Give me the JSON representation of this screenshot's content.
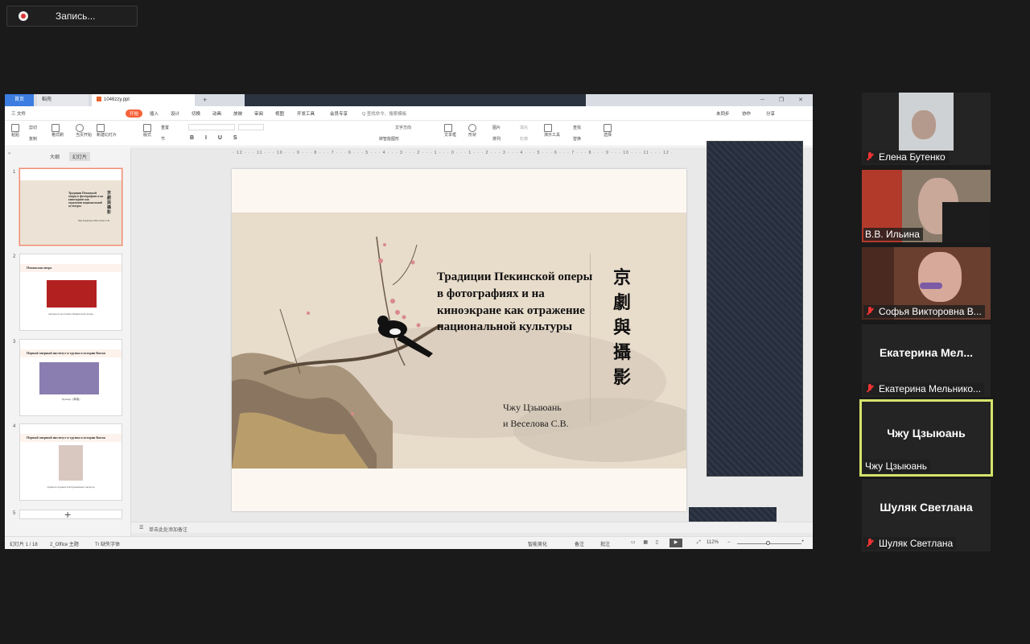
{
  "recording": {
    "label": "Запись..."
  },
  "window": {
    "tabs": {
      "home": "首页",
      "wps": "稻壳",
      "doc": "1046zzy.ppt",
      "plus": "+"
    },
    "menu": [
      "三 文件",
      "开始",
      "插入",
      "设计",
      "切换",
      "动画",
      "放映",
      "审阅",
      "视图",
      "开发工具",
      "会员专享",
      "Q 查找命令、搜索模板"
    ],
    "menu_right": [
      "未同步",
      "协作",
      "分享"
    ],
    "ribbon": {
      "paste": "粘贴",
      "cut": "剪切",
      "copy": "复制",
      "format": "格式刷",
      "from_current": "当页开始",
      "new_slide": "新建幻灯片",
      "layout": "版式",
      "section": "节",
      "reset": "重置",
      "textbox": "文本框",
      "shape": "形状",
      "picture": "图片",
      "arrange": "排列",
      "fill": "填充",
      "outline": "轮廓",
      "presentation_tools": "演示工具",
      "find": "查找",
      "replace": "替换",
      "select": "选择",
      "text_dir": "文字方向",
      "align_text": "对齐文本",
      "smartart": "转智能图形"
    },
    "pane_tabs": {
      "outline": "大纲",
      "slides": "幻灯片"
    },
    "slides": [
      {
        "n": "1",
        "title": "Традиции Пекинской оперы в фотографиях и на киноэкране как отражение национальной культуры",
        "vert": "京劇與攝影",
        "authors": "Чжу Цзыюань и Веселова С.В."
      },
      {
        "n": "2",
        "title": "Пекинская опера",
        "caption": "Актеры и костюмы Пекинской оперы"
      },
      {
        "n": "3",
        "title": "Первый оперный институт и труппа в истории Китая",
        "caption": "Пример. (寧壽)"
      },
      {
        "n": "4",
        "title": "Первый оперный институт и труппа в истории Китая",
        "caption": "Один из первых изображенных актеров"
      },
      {
        "n": "5"
      }
    ],
    "ruler": "· 12 · · · 11 · · · 10 · · · 9 · · · 8 · · · 7 · · · 6 · · · 5 · · · 4 · · · 3 · · · 2 · · · 1 · · · 0 · · · 1 · · · 2 · · · 3 · · · 4 · · · 5 · · · 6 · · · 7 · · · 8 · · · 9 · · · 10 · · · 11 · · · 12 ·",
    "main_slide": {
      "title": "Традиции Пекинской оперы в фотографиях и на киноэкране как отражение национальной культуры",
      "vert_chars": [
        "京",
        "劇",
        "與",
        "攝",
        "影"
      ],
      "author1": "Чжу Цзыюань",
      "author2": "и Веселова С.В."
    },
    "notes_placeholder": "单击此处添加备注",
    "status": {
      "slide_count": "幻灯片 1 / 18",
      "theme": "2_Office 主题",
      "font_missing": "缺失字体",
      "beautify": "智能美化",
      "notes": "备注",
      "comments": "批注",
      "zoom": "112%"
    }
  },
  "participants": [
    {
      "name": "Елена Бутенко",
      "muted": true
    },
    {
      "name": "В.В. Ильина",
      "muted": false
    },
    {
      "name": "Софья Викторовна В...",
      "muted": true
    },
    {
      "name": "Екатерина Мельнико...",
      "big": "Екатерина  Мел...",
      "muted": true
    },
    {
      "name": "Чжу Цзыюань",
      "big": "Чжу Цзыюань",
      "muted": false,
      "active": true
    },
    {
      "name": "Шуляк Светлана",
      "big": "Шуляк Светлана",
      "muted": true
    }
  ],
  "colors": {
    "accent_speaker": "#d5e36a",
    "wps_orange": "#f5623a",
    "mic_off": "#e33333"
  }
}
